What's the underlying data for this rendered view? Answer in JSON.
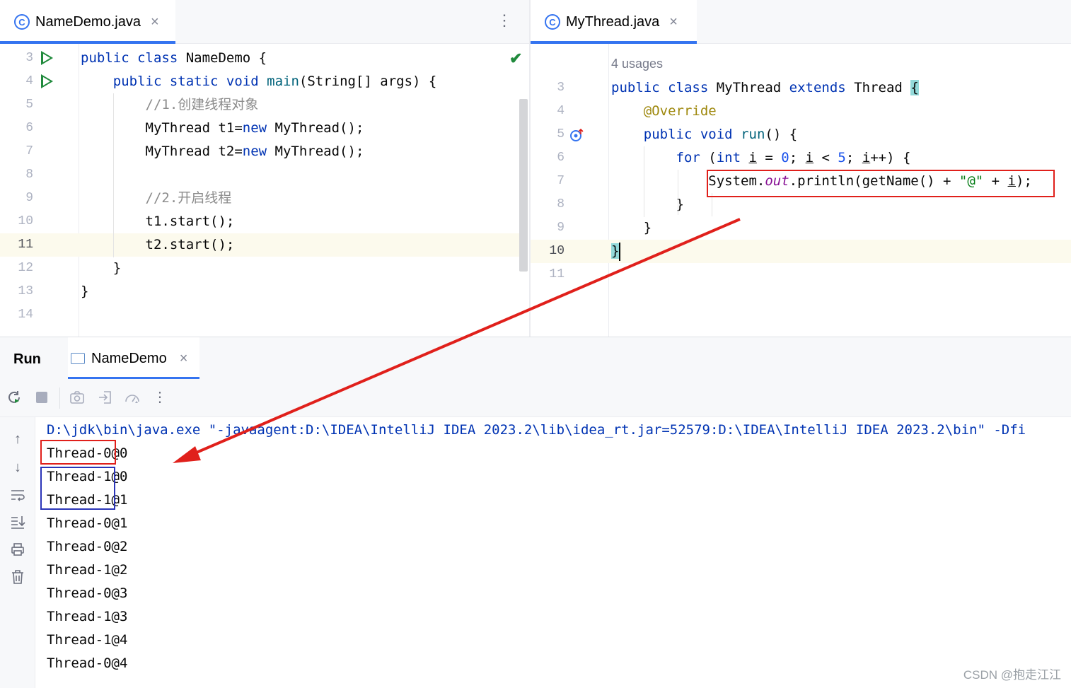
{
  "left_editor": {
    "tab": {
      "label": "NameDemo.java",
      "close": "×",
      "icon": "class-icon"
    },
    "menu": "⋮",
    "status": "✔",
    "lines": [
      {
        "n": "3",
        "html": "<span class=\"kw\">public class</span> NameDemo {"
      },
      {
        "n": "4",
        "html": "    <span class=\"kw\">public static void</span> <span class=\"fn\">main</span>(String[] args) {"
      },
      {
        "n": "5",
        "html": "        <span class=\"cm\">//1.创建线程对象</span>"
      },
      {
        "n": "6",
        "html": "        MyThread t1=<span class=\"kw\">new</span> MyThread();"
      },
      {
        "n": "7",
        "html": "        MyThread t2=<span class=\"kw\">new</span> MyThread();"
      },
      {
        "n": "8",
        "html": ""
      },
      {
        "n": "9",
        "html": "        <span class=\"cm\">//2.开启线程</span>"
      },
      {
        "n": "10",
        "html": "        t1.start();"
      },
      {
        "n": "11",
        "html": "        t2.start();"
      },
      {
        "n": "12",
        "html": "    }"
      },
      {
        "n": "13",
        "html": "}"
      },
      {
        "n": "14",
        "html": ""
      }
    ]
  },
  "right_editor": {
    "tab": {
      "label": "MyThread.java",
      "close": "×",
      "icon": "class-icon"
    },
    "usages": "4 usages",
    "lines": [
      {
        "n": "3",
        "html": "<span class=\"kw\">public class</span> MyThread <span class=\"kw\">extends</span> Thread <span style=\"background:#93d9d9\">{</span>"
      },
      {
        "n": "4",
        "html": "    <span class=\"an\">@Override</span>"
      },
      {
        "n": "5",
        "html": "    <span class=\"kw\">public void</span> <span class=\"fn\">run</span>() {"
      },
      {
        "n": "6",
        "html": "        <span class=\"kw\">for</span> (<span class=\"kw\">int</span> <span class=\"ul\">i</span> = <span class=\"num\">0</span>; <span class=\"ul\">i</span> &lt; <span class=\"num\">5</span>; <span class=\"ul\">i</span>++) {"
      },
      {
        "n": "7",
        "html": "            System.<span class=\"fld\">out</span>.println(getName() + <span class=\"st\">\"@\"</span> + <span class=\"ul\">i</span>);"
      },
      {
        "n": "8",
        "html": "        }"
      },
      {
        "n": "9",
        "html": "    }"
      },
      {
        "n": "10",
        "html": "<span style=\"background:#93d9d9\">}</span>"
      },
      {
        "n": "11",
        "html": ""
      }
    ]
  },
  "run": {
    "title": "Run",
    "tab_label": "NameDemo",
    "tab_close": "×",
    "command": "D:\\jdk\\bin\\java.exe \"-javaagent:D:\\IDEA\\IntelliJ IDEA 2023.2\\lib\\idea_rt.jar=52579:D:\\IDEA\\IntelliJ IDEA 2023.2\\bin\" -Dfi",
    "output": [
      "Thread-0@0",
      "Thread-1@0",
      "Thread-1@1",
      "Thread-0@1",
      "Thread-0@2",
      "Thread-1@2",
      "Thread-0@3",
      "Thread-1@3",
      "Thread-1@4",
      "Thread-0@4"
    ]
  },
  "watermark": "CSDN @抱走江江",
  "colors": {
    "accent": "#3574f0",
    "annotation_red": "#e0201b",
    "annotation_blue": "#2b35b8",
    "run_green": "#208a3c"
  }
}
